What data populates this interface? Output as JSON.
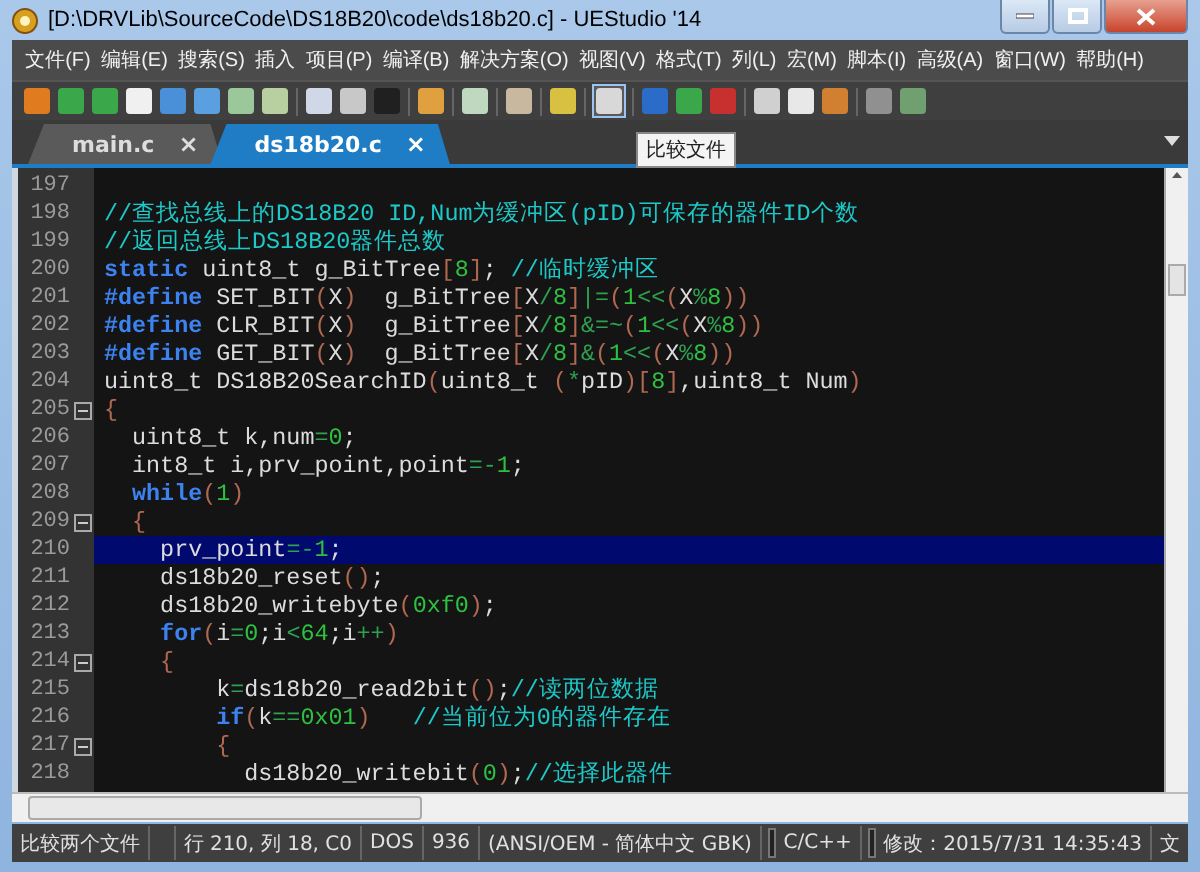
{
  "window": {
    "title": "[D:\\DRVLib\\SourceCode\\DS18B20\\code\\ds18b20.c] - UEStudio '14"
  },
  "menu": [
    "文件(F)",
    "编辑(E)",
    "搜索(S)",
    "插入",
    "项目(P)",
    "编译(B)",
    "解决方案(O)",
    "视图(V)",
    "格式(T)",
    "列(L)",
    "宏(M)",
    "脚本(I)",
    "高级(A)",
    "窗口(W)",
    "帮助(H)"
  ],
  "tooltip": "比较文件",
  "tabs": [
    {
      "label": "main.c",
      "selected": false,
      "close": "×"
    },
    {
      "label": "ds18b20.c",
      "selected": true,
      "close": "×"
    }
  ],
  "editor": {
    "lines": [
      {
        "number": "197",
        "fold": false,
        "selected": false
      },
      {
        "number": "198",
        "fold": false,
        "selected": false,
        "tokens": [
          {
            "kind": "comment",
            "t": "//查找总线上的DS18B20 ID,Num为缓冲区(pID)可保存的器件ID个数"
          }
        ]
      },
      {
        "number": "199",
        "fold": false,
        "selected": false,
        "tokens": [
          {
            "kind": "comment",
            "t": "//返回总线上DS18B20器件总数"
          }
        ]
      },
      {
        "number": "200",
        "fold": false,
        "selected": false,
        "tokens": [
          {
            "kind": "keyword",
            "t": "static"
          },
          {
            "kind": "plain",
            "t": " uint8_t g_BitTree"
          },
          {
            "kind": "paren",
            "t": "["
          },
          {
            "kind": "number",
            "t": "8"
          },
          {
            "kind": "paren",
            "t": "]"
          },
          {
            "kind": "plain",
            "t": "; "
          },
          {
            "kind": "comment",
            "t": "//临时缓冲区"
          }
        ]
      },
      {
        "number": "201",
        "fold": false,
        "selected": false,
        "tokens": [
          {
            "kind": "keyword",
            "t": "#define"
          },
          {
            "kind": "plain",
            "t": " SET_BIT"
          },
          {
            "kind": "paren",
            "t": "("
          },
          {
            "kind": "plain",
            "t": "X"
          },
          {
            "kind": "paren",
            "t": ")"
          },
          {
            "kind": "plain",
            "t": "  g_BitTree"
          },
          {
            "kind": "paren",
            "t": "["
          },
          {
            "kind": "plain",
            "t": "X"
          },
          {
            "kind": "op",
            "t": "/"
          },
          {
            "kind": "number",
            "t": "8"
          },
          {
            "kind": "paren",
            "t": "]"
          },
          {
            "kind": "op",
            "t": "|="
          },
          {
            "kind": "paren",
            "t": "("
          },
          {
            "kind": "number",
            "t": "1"
          },
          {
            "kind": "op",
            "t": "<<"
          },
          {
            "kind": "paren",
            "t": "("
          },
          {
            "kind": "plain",
            "t": "X"
          },
          {
            "kind": "op",
            "t": "%"
          },
          {
            "kind": "number",
            "t": "8"
          },
          {
            "kind": "paren",
            "t": "))"
          }
        ]
      },
      {
        "number": "202",
        "fold": false,
        "selected": false,
        "tokens": [
          {
            "kind": "keyword",
            "t": "#define"
          },
          {
            "kind": "plain",
            "t": " CLR_BIT"
          },
          {
            "kind": "paren",
            "t": "("
          },
          {
            "kind": "plain",
            "t": "X"
          },
          {
            "kind": "paren",
            "t": ")"
          },
          {
            "kind": "plain",
            "t": "  g_BitTree"
          },
          {
            "kind": "paren",
            "t": "["
          },
          {
            "kind": "plain",
            "t": "X"
          },
          {
            "kind": "op",
            "t": "/"
          },
          {
            "kind": "number",
            "t": "8"
          },
          {
            "kind": "paren",
            "t": "]"
          },
          {
            "kind": "op",
            "t": "&=~"
          },
          {
            "kind": "paren",
            "t": "("
          },
          {
            "kind": "number",
            "t": "1"
          },
          {
            "kind": "op",
            "t": "<<"
          },
          {
            "kind": "paren",
            "t": "("
          },
          {
            "kind": "plain",
            "t": "X"
          },
          {
            "kind": "op",
            "t": "%"
          },
          {
            "kind": "number",
            "t": "8"
          },
          {
            "kind": "paren",
            "t": "))"
          }
        ]
      },
      {
        "number": "203",
        "fold": false,
        "selected": false,
        "tokens": [
          {
            "kind": "keyword",
            "t": "#define"
          },
          {
            "kind": "plain",
            "t": " GET_BIT"
          },
          {
            "kind": "paren",
            "t": "("
          },
          {
            "kind": "plain",
            "t": "X"
          },
          {
            "kind": "paren",
            "t": ")"
          },
          {
            "kind": "plain",
            "t": "  g_BitTree"
          },
          {
            "kind": "paren",
            "t": "["
          },
          {
            "kind": "plain",
            "t": "X"
          },
          {
            "kind": "op",
            "t": "/"
          },
          {
            "kind": "number",
            "t": "8"
          },
          {
            "kind": "paren",
            "t": "]"
          },
          {
            "kind": "op",
            "t": "&"
          },
          {
            "kind": "paren",
            "t": "("
          },
          {
            "kind": "number",
            "t": "1"
          },
          {
            "kind": "op",
            "t": "<<"
          },
          {
            "kind": "paren",
            "t": "("
          },
          {
            "kind": "plain",
            "t": "X"
          },
          {
            "kind": "op",
            "t": "%"
          },
          {
            "kind": "number",
            "t": "8"
          },
          {
            "kind": "paren",
            "t": "))"
          }
        ]
      },
      {
        "number": "204",
        "fold": false,
        "selected": false,
        "tokens": [
          {
            "kind": "plain",
            "t": "uint8_t DS18B20SearchID"
          },
          {
            "kind": "paren",
            "t": "("
          },
          {
            "kind": "plain",
            "t": "uint8_t "
          },
          {
            "kind": "paren",
            "t": "("
          },
          {
            "kind": "op",
            "t": "*"
          },
          {
            "kind": "plain",
            "t": "pID"
          },
          {
            "kind": "paren",
            "t": ")["
          },
          {
            "kind": "number",
            "t": "8"
          },
          {
            "kind": "paren",
            "t": "]"
          },
          {
            "kind": "plain",
            "t": ",uint8_t Num"
          },
          {
            "kind": "paren",
            "t": ")"
          }
        ]
      },
      {
        "number": "205",
        "fold": true,
        "selected": false,
        "tokens": [
          {
            "kind": "paren",
            "t": "{"
          }
        ]
      },
      {
        "number": "206",
        "fold": false,
        "selected": false,
        "tokens": [
          {
            "kind": "plain",
            "t": "  uint8_t k,num"
          },
          {
            "kind": "op",
            "t": "="
          },
          {
            "kind": "number",
            "t": "0"
          },
          {
            "kind": "plain",
            "t": ";"
          }
        ]
      },
      {
        "number": "207",
        "fold": false,
        "selected": false,
        "tokens": [
          {
            "kind": "plain",
            "t": "  int8_t i,prv_point,point"
          },
          {
            "kind": "op",
            "t": "=-"
          },
          {
            "kind": "number",
            "t": "1"
          },
          {
            "kind": "plain",
            "t": ";"
          }
        ]
      },
      {
        "number": "208",
        "fold": false,
        "selected": false,
        "tokens": [
          {
            "kind": "keyword",
            "t": "  while"
          },
          {
            "kind": "paren",
            "t": "("
          },
          {
            "kind": "number",
            "t": "1"
          },
          {
            "kind": "paren",
            "t": ")"
          }
        ]
      },
      {
        "number": "209",
        "fold": true,
        "selected": false,
        "tokens": [
          {
            "kind": "paren",
            "t": "  {"
          }
        ]
      },
      {
        "number": "210",
        "fold": false,
        "selected": true,
        "tokens": [
          {
            "kind": "plain",
            "t": "    prv_point"
          },
          {
            "kind": "op",
            "t": "=-"
          },
          {
            "kind": "number",
            "t": "1"
          },
          {
            "kind": "plain",
            "t": ";"
          }
        ]
      },
      {
        "number": "211",
        "fold": false,
        "selected": false,
        "tokens": [
          {
            "kind": "plain",
            "t": "    ds18b20_reset"
          },
          {
            "kind": "paren",
            "t": "()"
          },
          {
            "kind": "plain",
            "t": ";"
          }
        ]
      },
      {
        "number": "212",
        "fold": false,
        "selected": false,
        "tokens": [
          {
            "kind": "plain",
            "t": "    ds18b20_writebyte"
          },
          {
            "kind": "paren",
            "t": "("
          },
          {
            "kind": "number",
            "t": "0xf0"
          },
          {
            "kind": "paren",
            "t": ")"
          },
          {
            "kind": "plain",
            "t": ";"
          }
        ]
      },
      {
        "number": "213",
        "fold": false,
        "selected": false,
        "tokens": [
          {
            "kind": "keyword",
            "t": "    for"
          },
          {
            "kind": "paren",
            "t": "("
          },
          {
            "kind": "plain",
            "t": "i"
          },
          {
            "kind": "op",
            "t": "="
          },
          {
            "kind": "number",
            "t": "0"
          },
          {
            "kind": "plain",
            "t": ";i"
          },
          {
            "kind": "op",
            "t": "<"
          },
          {
            "kind": "number",
            "t": "64"
          },
          {
            "kind": "plain",
            "t": ";i"
          },
          {
            "kind": "op",
            "t": "++"
          },
          {
            "kind": "paren",
            "t": ")"
          }
        ]
      },
      {
        "number": "214",
        "fold": true,
        "selected": false,
        "tokens": [
          {
            "kind": "paren",
            "t": "    {"
          }
        ]
      },
      {
        "number": "215",
        "fold": false,
        "selected": false,
        "tokens": [
          {
            "kind": "plain",
            "t": "        k"
          },
          {
            "kind": "op",
            "t": "="
          },
          {
            "kind": "plain",
            "t": "ds18b20_read2bit"
          },
          {
            "kind": "paren",
            "t": "()"
          },
          {
            "kind": "plain",
            "t": ";"
          },
          {
            "kind": "comment",
            "t": "//读两位数据"
          }
        ]
      },
      {
        "number": "216",
        "fold": false,
        "selected": false,
        "tokens": [
          {
            "kind": "keyword",
            "t": "        if"
          },
          {
            "kind": "paren",
            "t": "("
          },
          {
            "kind": "plain",
            "t": "k"
          },
          {
            "kind": "op",
            "t": "=="
          },
          {
            "kind": "number",
            "t": "0x01"
          },
          {
            "kind": "paren",
            "t": ")"
          },
          {
            "kind": "comment",
            "t": "   //当前位为0的器件存在"
          }
        ]
      },
      {
        "number": "217",
        "fold": true,
        "selected": false,
        "tokens": [
          {
            "kind": "paren",
            "t": "        {"
          }
        ]
      },
      {
        "number": "218",
        "fold": false,
        "selected": false,
        "tokens": [
          {
            "kind": "plain",
            "t": "          ds18b20_writebit"
          },
          {
            "kind": "paren",
            "t": "("
          },
          {
            "kind": "number",
            "t": "0"
          },
          {
            "kind": "paren",
            "t": ")"
          },
          {
            "kind": "plain",
            "t": ";"
          },
          {
            "kind": "comment",
            "t": "//选择此器件"
          }
        ]
      }
    ]
  },
  "status_bar": {
    "message": "比较两个文件",
    "position": "行 210, 列 18, C0",
    "line_ending": "DOS",
    "codepage": "936",
    "encoding": "(ANSI/OEM - 简体中文 GBK)",
    "language": "C/C++",
    "modified": "修改：2015/7/31 14:35:43",
    "ime": "文"
  }
}
